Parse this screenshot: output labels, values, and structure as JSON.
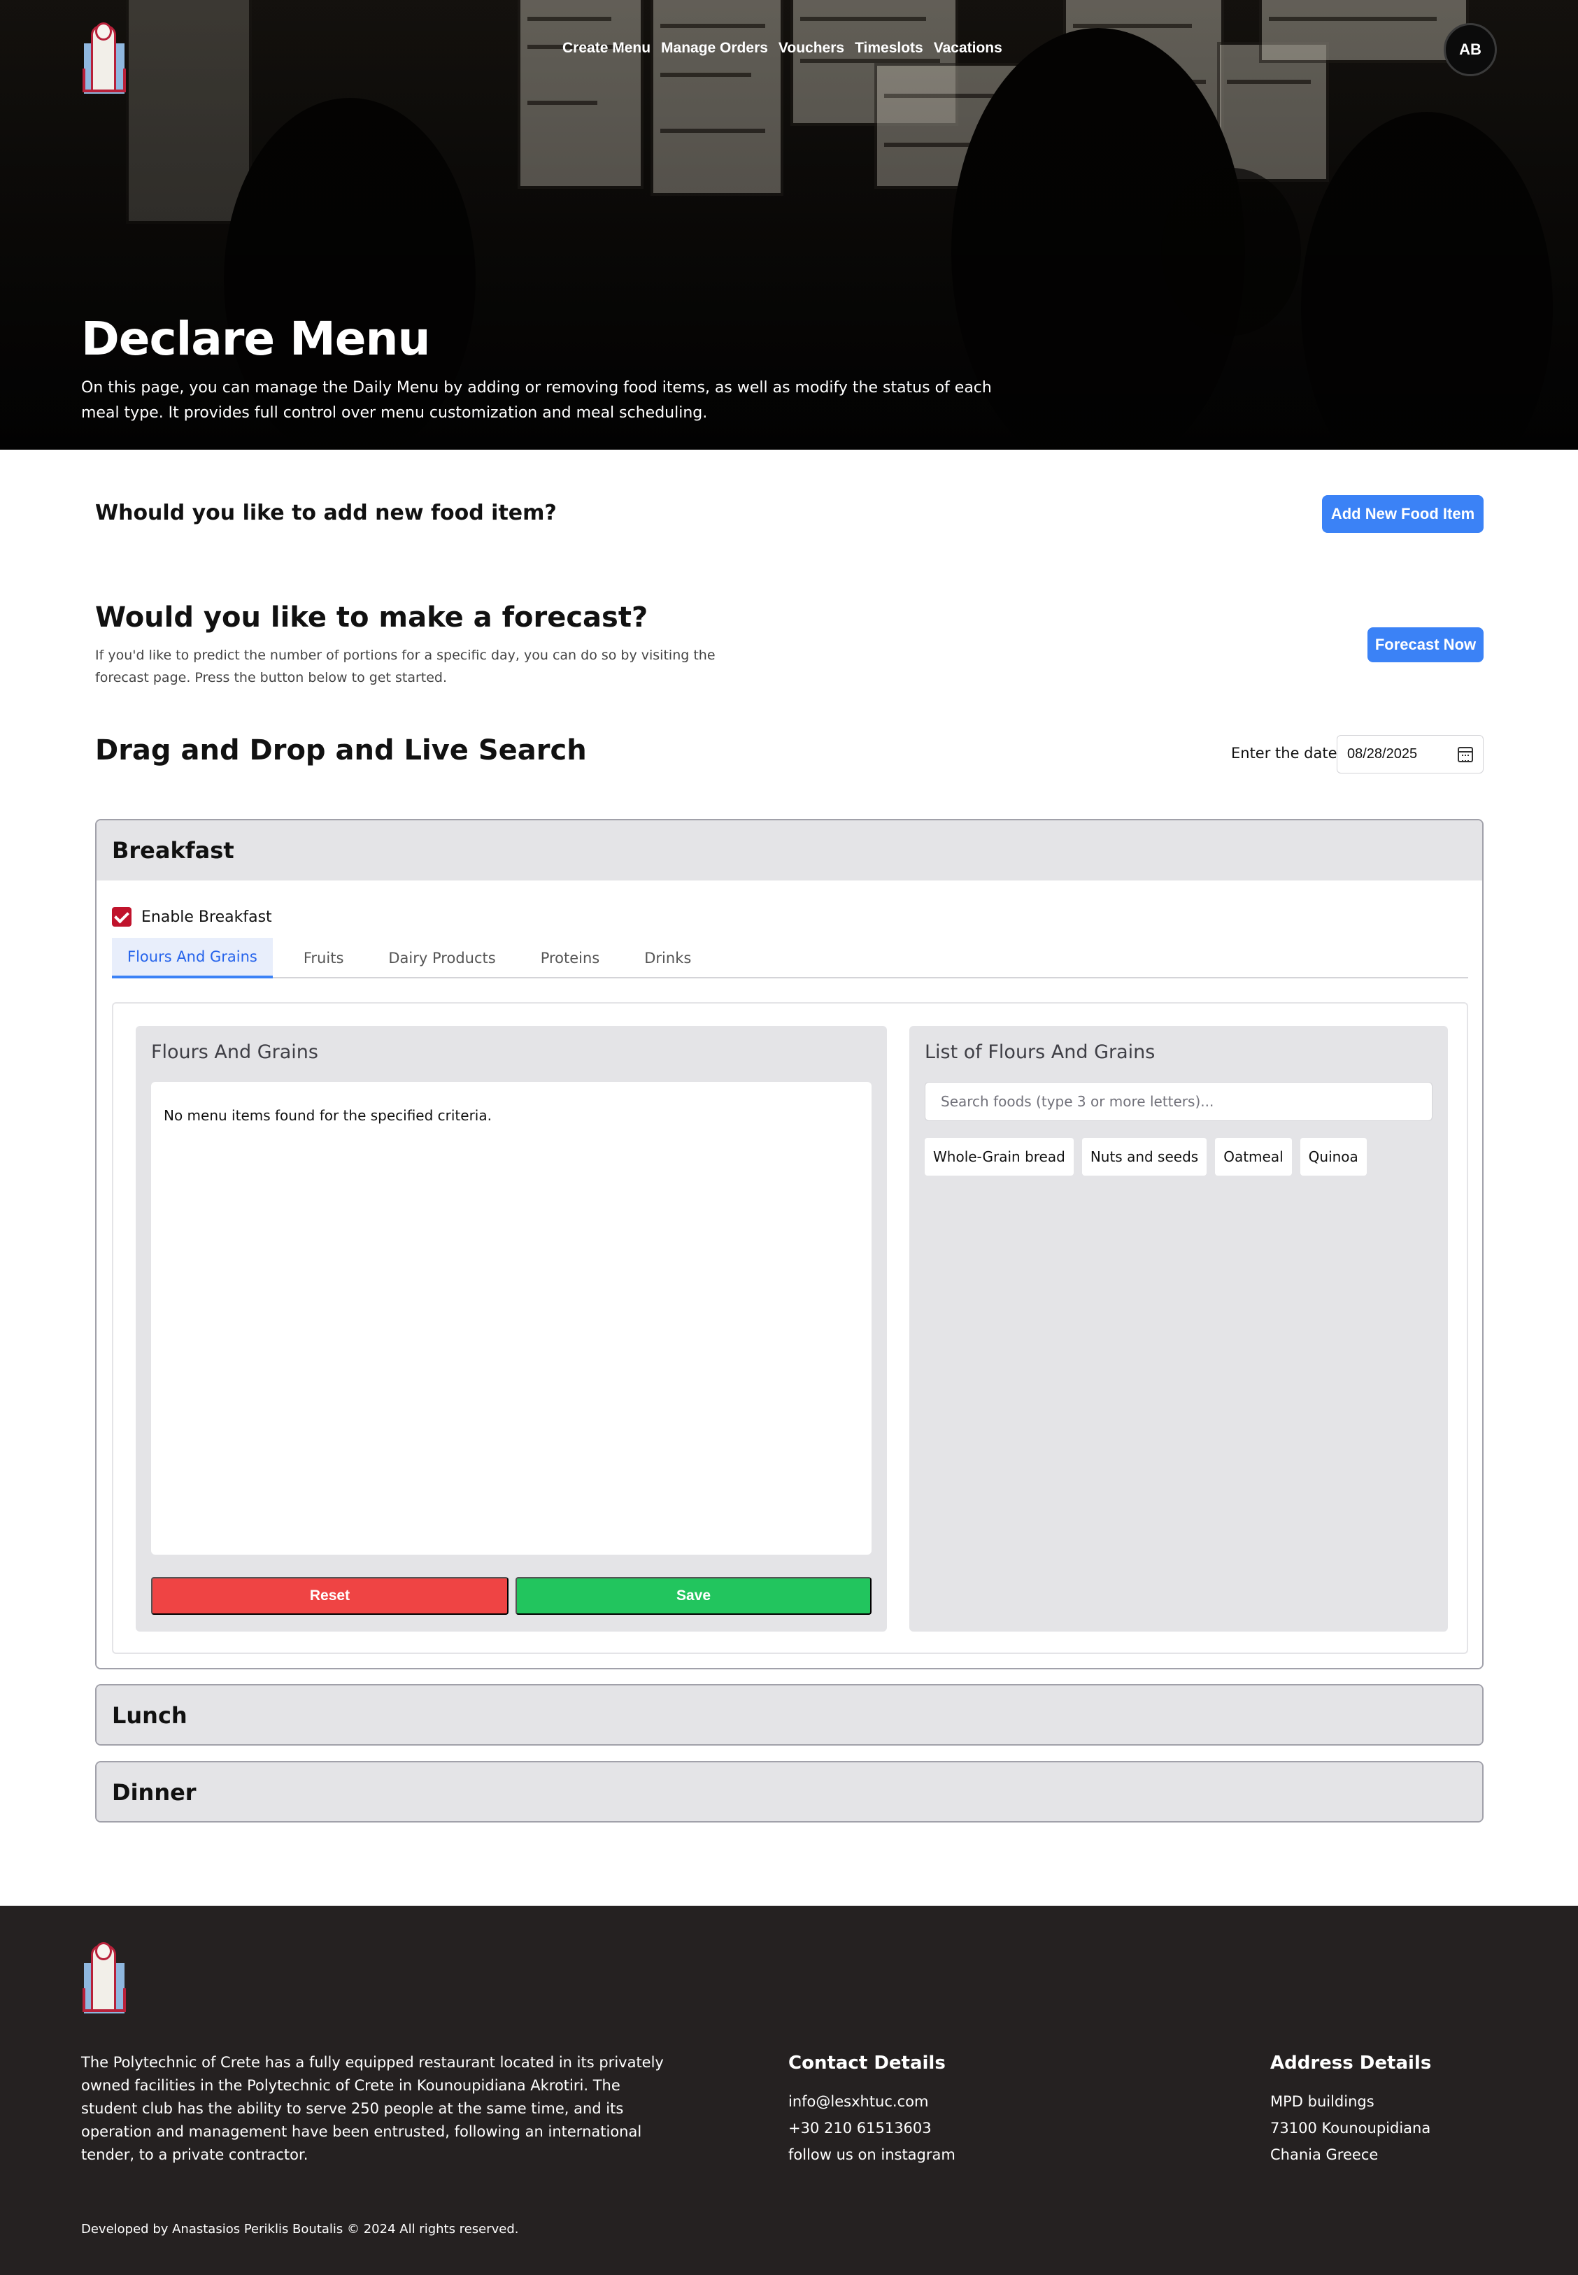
{
  "nav": {
    "items": [
      "Create Menu",
      "Manage Orders",
      "Vouchers",
      "Timeslots",
      "Vacations"
    ],
    "avatar_initials": "AB"
  },
  "hero": {
    "title": "Declare Menu",
    "description": "On this page, you can manage the Daily Menu by adding or removing food items, as well as modify the status of each meal type. It provides full control over menu customization and meal scheduling."
  },
  "add_food": {
    "question": "Whould you like to add new food item?",
    "button": "Add New Food Item"
  },
  "forecast": {
    "question": "Would you like to make a forecast?",
    "description": "If you'd like to predict the number of portions for a specific day, you can do so by visiting the forecast page. Press the button below to get started.",
    "button": "Forecast Now"
  },
  "dnd": {
    "title": "Drag and Drop and Live Search",
    "date_label": "Enter the date",
    "date_value": "08/28/2025"
  },
  "meals": {
    "breakfast": {
      "title": "Breakfast",
      "enable_label": "Enable Breakfast",
      "enabled": true,
      "tabs": [
        "Flours And Grains",
        "Fruits",
        "Dairy Products",
        "Proteins",
        "Drinks"
      ],
      "active_tab": "Flours And Grains",
      "selected_title": "Flours And Grains",
      "empty_message": "No menu items found for the specified criteria.",
      "reset_label": "Reset",
      "save_label": "Save",
      "list_title": "List of Flours And Grains",
      "search_placeholder": "Search foods (type 3 or more letters)...",
      "foods": [
        "Whole-Grain bread",
        "Nuts and seeds",
        "Oatmeal",
        "Quinoa"
      ]
    },
    "lunch": {
      "title": "Lunch"
    },
    "dinner": {
      "title": "Dinner"
    }
  },
  "footer": {
    "description": "The Polytechnic of Crete has a fully equipped restaurant located in its privately owned facilities in the Polytechnic of Crete in Kounoupidiana Akrotiri. The student club has the ability to serve 250 people at the same time, and its operation and management have been entrusted, following an international tender, to a private contractor.",
    "contact": {
      "title": "Contact Details",
      "email": "info@lesxhtuc.com",
      "phone": "+30 210 61513603",
      "social": "follow us on instagram"
    },
    "address": {
      "title": "Address Details",
      "line1": "MPD buildings",
      "line2": "73100 Kounoupidiana",
      "line3": "Chania Greece"
    },
    "copyright": "Developed by Anastasios Periklis Boutalis © 2024 All rights reserved."
  },
  "colors": {
    "primary": "#3b82f6",
    "danger": "#ef4444",
    "success": "#22c55e",
    "checkbox": "#c0132c",
    "footer_bg": "#252121"
  }
}
